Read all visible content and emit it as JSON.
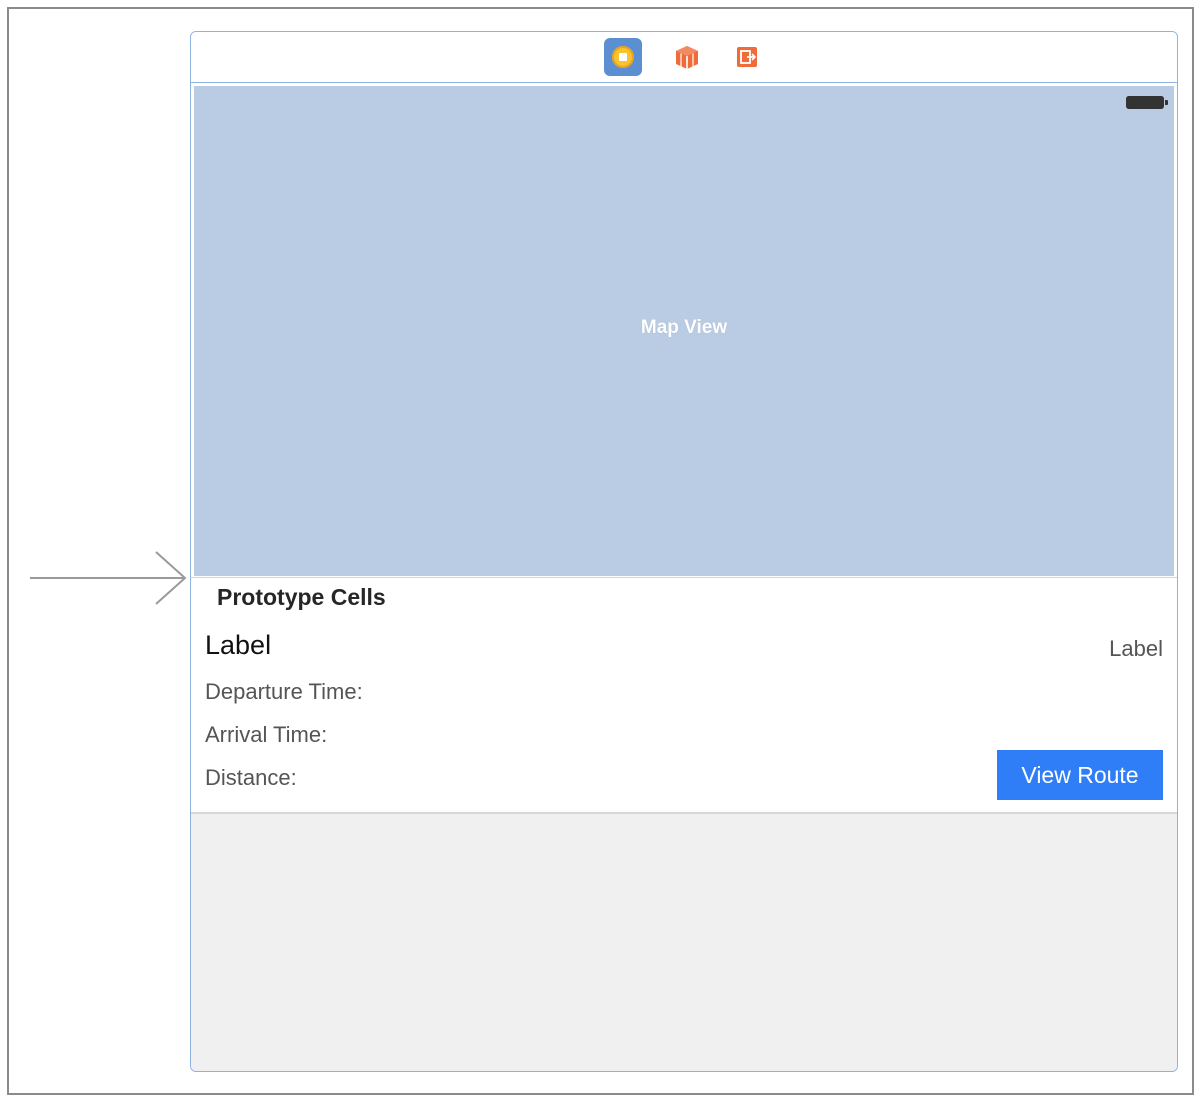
{
  "scene": {
    "map_view_label": "Map View",
    "table": {
      "section_header": "Prototype Cells",
      "cell": {
        "title": "Label",
        "detail": "Label",
        "departure_label": "Departure Time:",
        "arrival_label": "Arrival Time:",
        "distance_label": "Distance:",
        "view_route_button": "View Route"
      }
    }
  },
  "icons": {
    "dock": [
      "view-controller-icon",
      "first-responder-icon",
      "exit-icon"
    ],
    "status_bar": [
      "battery-icon"
    ],
    "canvas": [
      "entry-point-arrow-icon"
    ]
  },
  "colors": {
    "map_view_bg": "#bacce3",
    "button_blue": "#2f7ef7",
    "selection_border": "#8fb3df",
    "dock_orange": "#ef6b3a",
    "empty_table_bg": "#f1f0f0"
  }
}
